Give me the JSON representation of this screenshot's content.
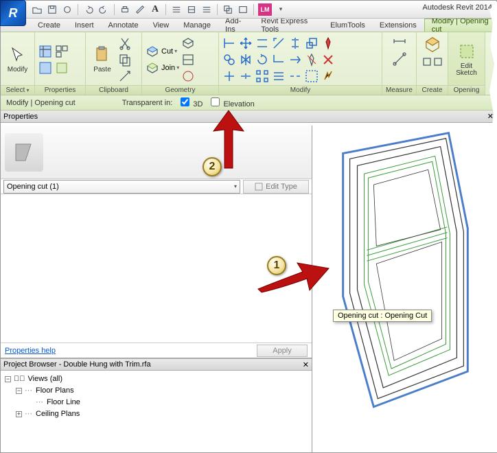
{
  "app_title": "Autodesk Revit 2014",
  "tabs": [
    "Create",
    "Insert",
    "Annotate",
    "View",
    "Manage",
    "Add-Ins",
    "Revit Express Tools",
    "ElumTools",
    "Extensions",
    "Modify | Opening cut"
  ],
  "active_tab_index": 9,
  "ribbon": {
    "select": {
      "label": "Select",
      "modify": "Modify"
    },
    "properties": {
      "label": "Properties"
    },
    "clipboard": {
      "label": "Clipboard",
      "paste": "Paste"
    },
    "geometry": {
      "label": "Geometry",
      "cut": "Cut",
      "join": "Join"
    },
    "modify": {
      "label": "Modify"
    },
    "measure": {
      "label": "Measure"
    },
    "create": {
      "label": "Create"
    },
    "opening": {
      "label": "Opening",
      "edit": "Edit",
      "sketch": "Sketch"
    }
  },
  "optionsbar": {
    "context": "Modify | Opening cut",
    "transparent_label": "Transparent in:",
    "cb_3d_label": "3D",
    "cb_3d_checked": true,
    "cb_elev_label": "Elevation",
    "cb_elev_checked": false
  },
  "properties": {
    "title": "Properties",
    "type_selected": "Opening cut (1)",
    "edit_type": "Edit Type",
    "help": "Properties help",
    "apply": "Apply"
  },
  "browser": {
    "title": "Project Browser - Double Hung with Trim.rfa",
    "root": "Views (all)",
    "floor_plans": "Floor Plans",
    "floor_line": "Floor Line",
    "ceiling_plans": "Ceiling Plans"
  },
  "tooltip": "Opening cut : Opening Cut",
  "callouts": {
    "one": "1",
    "two": "2"
  }
}
